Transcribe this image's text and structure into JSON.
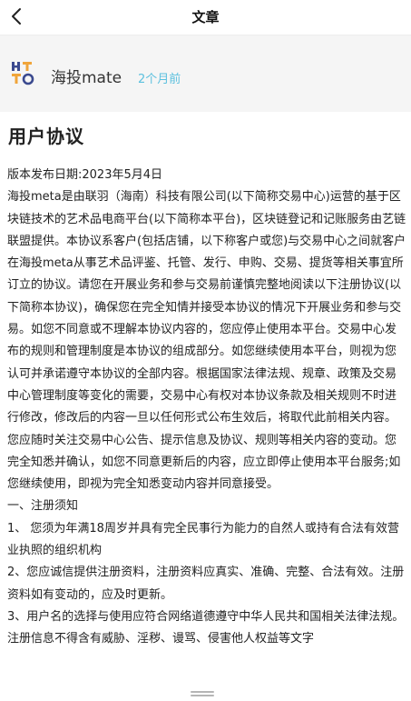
{
  "nav": {
    "title": "文章",
    "back_icon": "chevron-left-icon"
  },
  "author": {
    "name": "海投mate",
    "time": "2个月前",
    "time_color": "#5bc0de",
    "logo_text": "HT"
  },
  "article": {
    "title": "用户协议",
    "paragraphs": [
      "版本发布日期:2023年5月4日",
      "海投meta是由联羽（海南）科技有限公司(以下简称交易中心)运营的基于区块链技术的艺术品电商平台(以下简称本平台)，区块链登记和记账服务由艺链联盟提供。本协议系客户(包括店铺，以下称客户或您)与交易中心之间就客户在海投meta从事艺术品评鉴、托管、发行、申购、交易、提货等相关事宜所订立的协议。请您在开展业务和参与交易前谨慎完整地阅读以下注册协议(以下简称本协议)，确保您在完全知情并接受本协议的情况下开展业务和参与交易。如您不同意或不理解本协议内容的，您应停止使用本平台。交易中心发布的规则和管理制度是本协议的组成部分。如您继续使用本平台，则视为您认可并承诺遵守本协议的全部内容。根据国家法律法规、规章、政策及交易中心管理制度等变化的需要，交易中心有权对本协议条款及相关规则不时进行修改，修改后的内容一旦以任何形式公布生效后，将取代此前相关内容。您应随时关注交易中心公告、提示信息及协议、规则等相关内容的变动。您完全知悉并确认，如您不同意更新后的内容，应立即停止使用本平台服务;如您继续使用，即视为完全知悉变动内容并同意接受。",
      "一、注册须知",
      "1、  您须为年满18周岁并具有完全民事行为能力的自然人或持有合法有效营业执照的组织机构",
      "2、您应诚信提供注册资料，注册资料应真实、准确、完整、合法有效。注册资料如有变动的，应及时更新。",
      "3、用户名的选择与使用应符合网络道德遵守中华人民共和国相关法律法规。注册信息不得含有威胁、淫秽、谩骂、侵害他人权益等文字"
    ]
  }
}
